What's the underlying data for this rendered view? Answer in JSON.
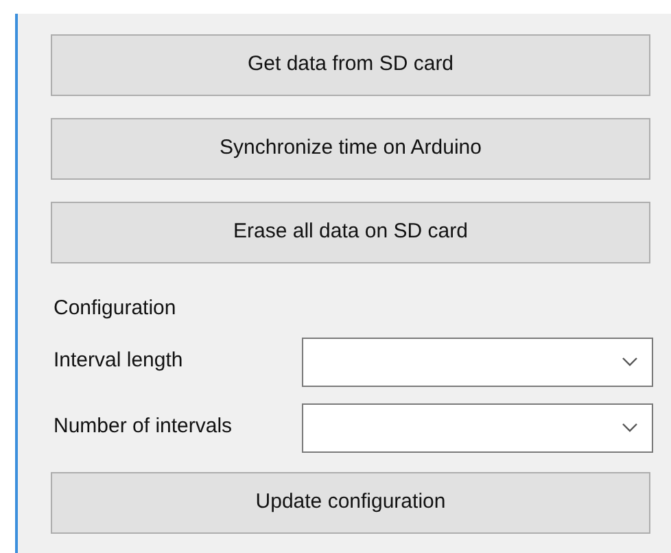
{
  "actions": [
    {
      "label": "Get data from SD card"
    },
    {
      "label": "Synchronize time on Arduino"
    },
    {
      "label": "Erase all data on SD card"
    }
  ],
  "configuration": {
    "title": "Configuration",
    "fields": [
      {
        "label": "Interval length"
      },
      {
        "label": "Number of intervals"
      }
    ],
    "button": "Update configuration"
  }
}
